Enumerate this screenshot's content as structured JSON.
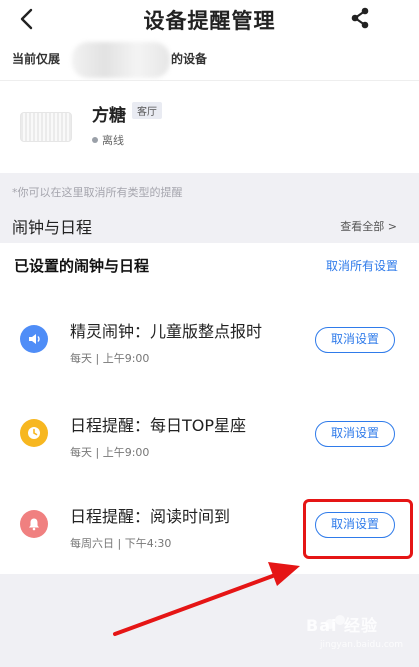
{
  "header": {
    "title": "设备提醒管理"
  },
  "scope": {
    "prefix": "当前仅展",
    "suffix": "的设备"
  },
  "device": {
    "name": "方糖",
    "room": "客厅",
    "status": "离线"
  },
  "hint": "*你可以在这里取消所有类型的提醒",
  "section": {
    "title": "闹钟与日程",
    "view_all": "查看全部 >"
  },
  "list": {
    "header": "已设置的闹钟与日程",
    "cancel_all": "取消所有设置",
    "items": [
      {
        "title": "精灵闹钟：儿童版整点报时",
        "time": "每天 | 上午9:00",
        "button": "取消设置",
        "icon": "speaker-icon",
        "color": "#4f8df7"
      },
      {
        "title": "日程提醒：每日TOP星座",
        "time": "每天 | 上午9:00",
        "button": "取消设置",
        "icon": "clock-icon",
        "color": "#f7b720"
      },
      {
        "title": "日程提醒：阅读时间到",
        "time": "每周六日 | 下午4:30",
        "button": "取消设置",
        "icon": "bell-icon",
        "color": "#f08080"
      }
    ]
  },
  "annotation": {
    "highlight_color": "#e51515"
  },
  "watermark": {
    "text": "Bai 经验",
    "sub": "jingyan.baidu.com"
  }
}
